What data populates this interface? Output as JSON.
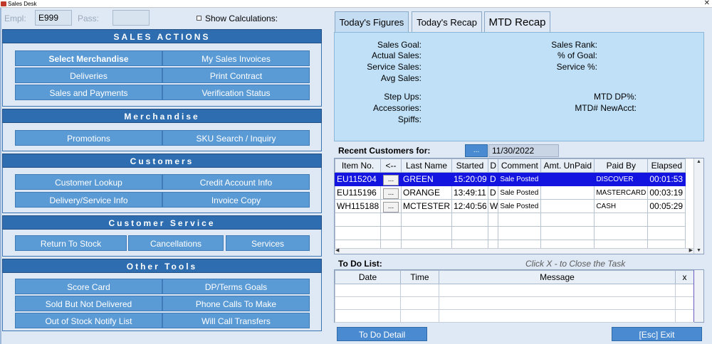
{
  "window": {
    "title": "Sales Desk",
    "close_glyph": "✕"
  },
  "login": {
    "empl_label": "Empl:",
    "empl_value": "E999",
    "pass_label": "Pass:",
    "pass_value": "",
    "show_calc_label": "Show Calculations:",
    "show_calc_checked": false
  },
  "left_panel": {
    "sales_actions": {
      "header": "SALES ACTIONS",
      "buttons": [
        "Select Merchandise",
        "My Sales Invoices",
        "Deliveries",
        "Print Contract",
        "Sales and Payments",
        "Verification Status"
      ]
    },
    "merchandise": {
      "header": "Merchandise",
      "buttons": [
        "Promotions",
        "SKU Search / Inquiry"
      ]
    },
    "customers": {
      "header": "Customers",
      "buttons": [
        "Customer Lookup",
        "Credit Account Info",
        "Delivery/Service Info",
        "Invoice Copy"
      ]
    },
    "customer_service": {
      "header": "Customer Service",
      "buttons": [
        "Return To Stock",
        "Cancellations",
        "Services"
      ]
    },
    "other_tools": {
      "header": "Other Tools",
      "buttons": [
        "Score Card",
        "DP/Terms Goals",
        "Sold But Not Delivered",
        "Phone Calls To Make",
        "Out of Stock Notify List",
        "Will Call Transfers"
      ]
    }
  },
  "tabs": [
    "Today's Figures",
    "Today's Recap",
    "MTD Recap"
  ],
  "figures": {
    "left": [
      "Sales Goal:",
      "Actual Sales:",
      "Service Sales:",
      "Avg Sales:",
      "Step Ups:",
      "Accessories:",
      "Spiffs:"
    ],
    "right": [
      "Sales Rank:",
      "% of Goal:",
      "Service %:",
      "MTD DP%:",
      "MTD# NewAcct:"
    ]
  },
  "recent_customers": {
    "label": "Recent Customers for:",
    "picker_label": "...",
    "date": "11/30/2022",
    "columns": [
      "Item No.",
      "<--",
      "Last Name",
      "Started",
      "D",
      "Comment",
      "Amt. UnPaid",
      "Paid By",
      "Elapsed"
    ],
    "rows": [
      {
        "item": "EU115204",
        "btn": "...",
        "last": "GREEN",
        "started": "15:20:09",
        "d": "D",
        "comment": "Sale Posted",
        "unpaid": "",
        "paid_by": "DISCOVER",
        "elapsed": "00:01:53"
      },
      {
        "item": "EU115196",
        "btn": "...",
        "last": "ORANGE",
        "started": "13:49:11",
        "d": "D",
        "comment": "Sale Posted",
        "unpaid": "",
        "paid_by": "MASTERCARD",
        "elapsed": "00:03:19"
      },
      {
        "item": "WH115188",
        "btn": "...",
        "last": "MCTESTER",
        "started": "12:40:56",
        "d": "W",
        "comment": "Sale Posted",
        "unpaid": "",
        "paid_by": "CASH",
        "elapsed": "00:05:29"
      }
    ]
  },
  "todo": {
    "label": "To Do List:",
    "hint": "Click  X - to Close the Task",
    "columns": [
      "Date",
      "Time",
      "Message",
      "x"
    ]
  },
  "footer": {
    "todo_detail": "To Do Detail",
    "exit": "[Esc]  Exit"
  },
  "colors": {
    "section_header": "#2d6db0",
    "button": "#5b9bd5",
    "selected_row": "#1414e0",
    "figures_bg": "#bfe0f7"
  }
}
